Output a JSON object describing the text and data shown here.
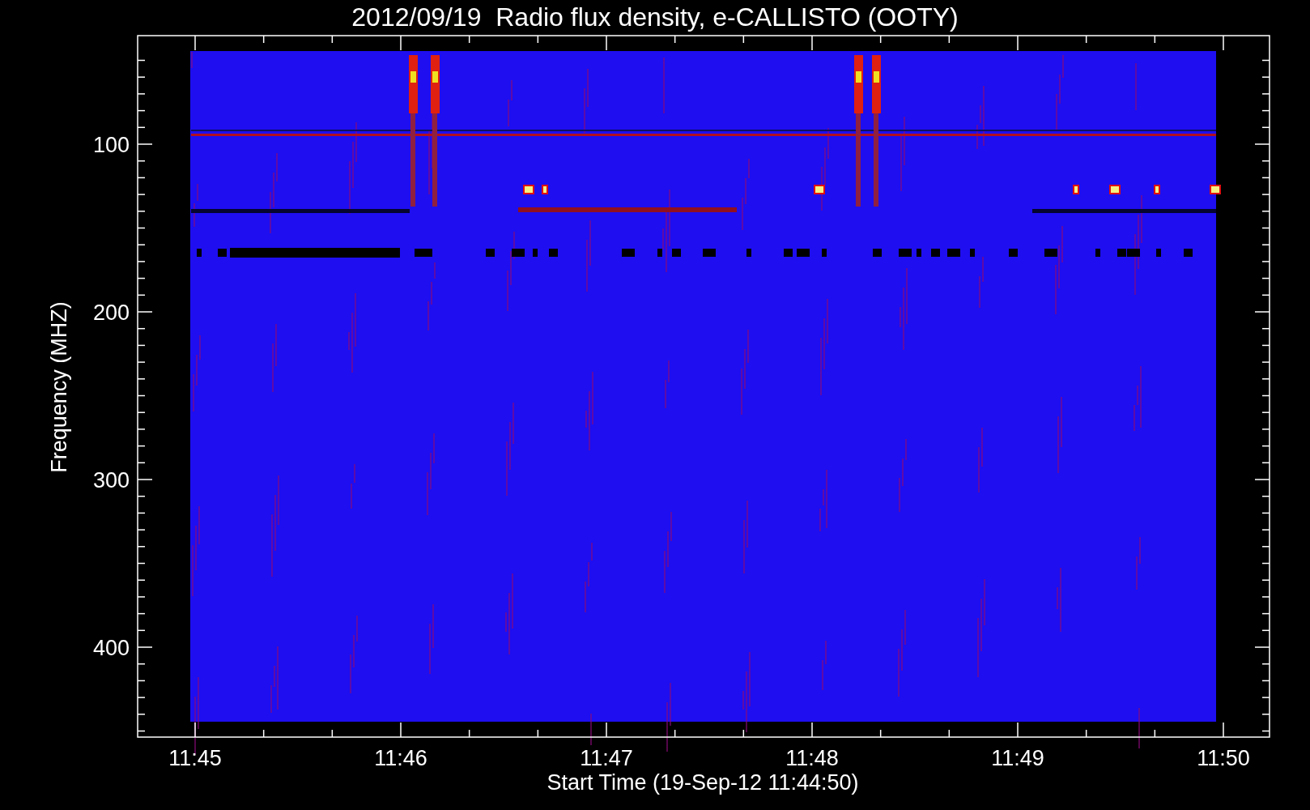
{
  "title": "2012/09/19  Radio flux density, e-CALLISTO (OOTY)",
  "xlabel": "Start Time (19-Sep-12 11:44:50)",
  "ylabel": "Frequency (MHZ)",
  "xticks": [
    "11:45",
    "11:46",
    "11:47",
    "11:48",
    "11:49",
    "11:50"
  ],
  "yticks": [
    "100",
    "200",
    "300",
    "400"
  ]
}
